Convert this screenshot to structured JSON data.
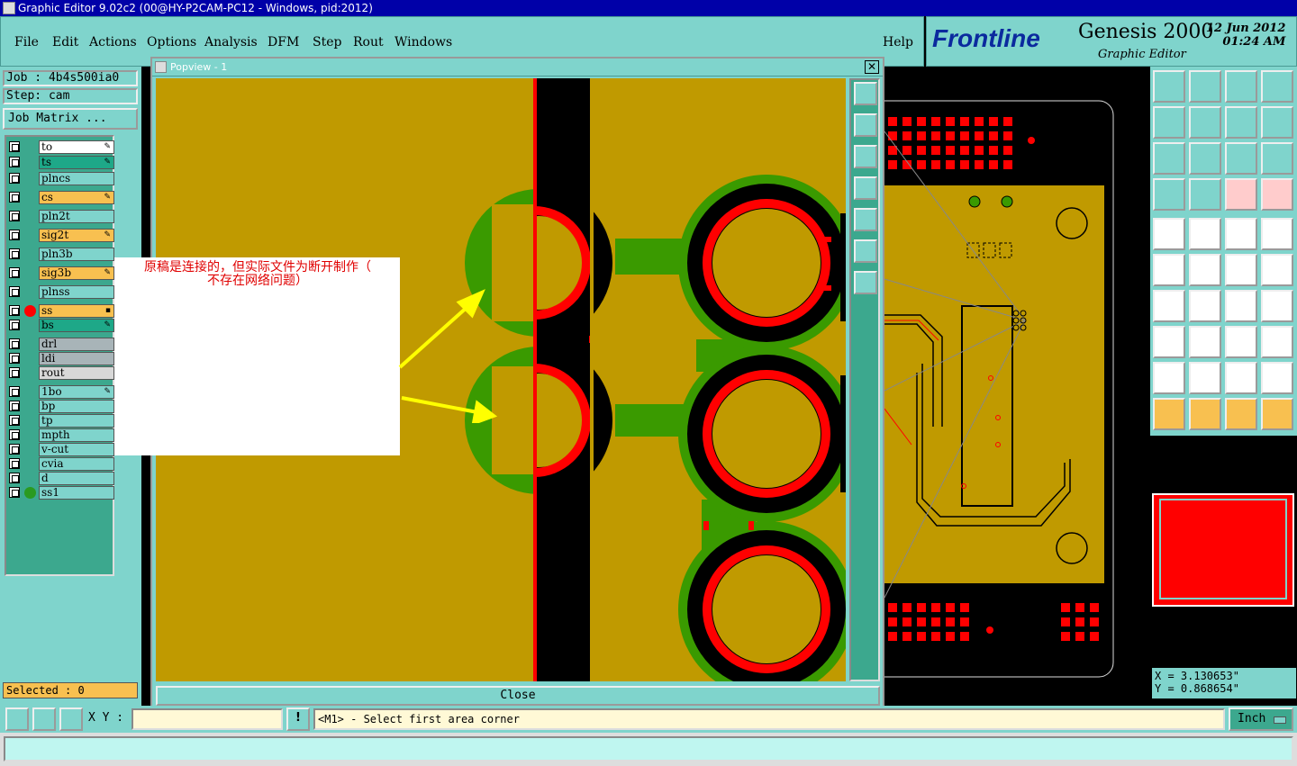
{
  "window": {
    "title": "Graphic Editor 9.02c2 (00@HY-P2CAM-PC12 - Windows, pid:2012)"
  },
  "menu": [
    "File",
    "Edit",
    "Actions",
    "Options",
    "Analysis",
    "DFM",
    "Step",
    "Rout",
    "Windows"
  ],
  "help_label": "Help",
  "brand": {
    "logo": "Frontline",
    "product": "Genesis 2000",
    "subtitle": "Graphic Editor",
    "date": "12 Jun 2012",
    "time": "01:24 AM"
  },
  "job": {
    "job_label": "Job : 4b4s500ia0",
    "step_label": "Step: cam",
    "matrix_button": "Job Matrix ..."
  },
  "layers": [
    {
      "name": "to",
      "bg": "#ffffff",
      "dot": "",
      "mark": "✎"
    },
    {
      "name": "ts",
      "bg": "#1ea888",
      "dot": "",
      "mark": "✎"
    },
    {
      "name": "plncs",
      "bg": "#7fd4cc",
      "dot": "",
      "mark": ""
    },
    {
      "name": "cs",
      "bg": "#f8c050",
      "dot": "",
      "mark": "✎"
    },
    {
      "name": "pln2t",
      "bg": "#7fd4cc",
      "dot": "",
      "mark": ""
    },
    {
      "name": "sig2t",
      "bg": "#f8c050",
      "dot": "",
      "mark": "✎"
    },
    {
      "name": "pln3b",
      "bg": "#7fd4cc",
      "dot": "",
      "mark": ""
    },
    {
      "name": "sig3b",
      "bg": "#f8c050",
      "dot": "",
      "mark": "✎"
    },
    {
      "name": "plnss",
      "bg": "#7fd4cc",
      "dot": "",
      "mark": ""
    },
    {
      "name": "ss",
      "bg": "#f8c050",
      "dot": "#ff0000",
      "mark": "▪"
    },
    {
      "name": "bs",
      "bg": "#1ea888",
      "dot": "",
      "mark": "✎"
    },
    {
      "name": "drl",
      "bg": "#a8b4b8",
      "dot": "",
      "mark": ""
    },
    {
      "name": "ldi",
      "bg": "#a8b4b8",
      "dot": "",
      "mark": ""
    },
    {
      "name": "rout",
      "bg": "#d8d8d8",
      "dot": "",
      "mark": ""
    },
    {
      "name": "1bo",
      "bg": "#7fd4cc",
      "dot": "",
      "mark": "✎"
    },
    {
      "name": "bp",
      "bg": "#7fd4cc",
      "dot": "",
      "mark": ""
    },
    {
      "name": "tp",
      "bg": "#7fd4cc",
      "dot": "",
      "mark": ""
    },
    {
      "name": "mpth",
      "bg": "#7fd4cc",
      "dot": "",
      "mark": ""
    },
    {
      "name": "v-cut",
      "bg": "#7fd4cc",
      "dot": "",
      "mark": ""
    },
    {
      "name": "cvia",
      "bg": "#7fd4cc",
      "dot": "",
      "mark": ""
    },
    {
      "name": "d",
      "bg": "#7fd4cc",
      "dot": "",
      "mark": ""
    },
    {
      "name": "ss1",
      "bg": "#7fd4cc",
      "dot": "#2a9a20",
      "mark": ""
    }
  ],
  "selected_label": "Selected : 0",
  "popview": {
    "title": "Popview - 1",
    "close_label": "Close"
  },
  "annotation": {
    "line1": "原稿是连接的，但实际文件为断开制作（",
    "line2": "不存在网络问题）"
  },
  "coords": {
    "x": "X = 3.130653\"",
    "y": "Y = 0.868654\""
  },
  "status": {
    "xy_label": "X Y :",
    "xy_value": "",
    "prompt": "<M1> - Select first area corner",
    "units": "Inch"
  },
  "colors": {
    "panel": "#7fd4cc",
    "copper": "#c09a00",
    "red": "#ff0000",
    "green": "#3a9a00"
  }
}
